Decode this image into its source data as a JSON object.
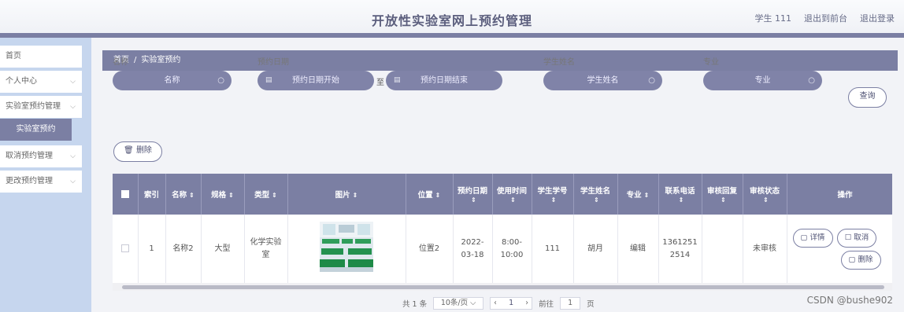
{
  "header": {
    "title": "开放性实验室网上预约管理",
    "user_label": "学生 111",
    "to_front_label": "退出到前台",
    "logout_label": "退出登录"
  },
  "sidebar": {
    "items": [
      {
        "label": "首页",
        "chevron": false
      },
      {
        "label": "个人中心",
        "chevron": true
      },
      {
        "label": "实验室预约管理",
        "chevron": true
      },
      {
        "label": "取消预约管理",
        "chevron": true
      },
      {
        "label": "更改预约管理",
        "chevron": true
      }
    ],
    "active_sub": "实验室预约"
  },
  "breadcrumb": {
    "home": "首页",
    "separator": "/",
    "current": "实验室预约"
  },
  "filters": {
    "name_label": "名称",
    "name_placeholder": "名称",
    "date_label": "预约日期",
    "date_start_placeholder": "预约日期开始",
    "date_to": "至",
    "date_end_placeholder": "预约日期结束",
    "student_label": "学生姓名",
    "student_placeholder": "学生姓名",
    "major_label": "专业",
    "major_placeholder": "专业",
    "query_button": "查询",
    "delete_button": "删除",
    "delete_icon": "trash-icon"
  },
  "table": {
    "headers": [
      "",
      "索引",
      "名称",
      "规格",
      "类型",
      "图片",
      "位置",
      "预约日期",
      "使用时间",
      "学生学号",
      "学生姓名",
      "专业",
      "联系电话",
      "审核回复",
      "审核状态",
      "操作"
    ],
    "rows": [
      {
        "index": "1",
        "name": "名称2",
        "spec": "大型",
        "type": "化学实验室",
        "image": "classroom-photo",
        "location": "位置2",
        "date": "2022-03-18",
        "time": "8:00-10:00",
        "student_id": "111",
        "student_name": "胡月",
        "major": "编辑",
        "phone": "13612512514",
        "reply": "",
        "status": "未审核",
        "actions": {
          "detail": "详情",
          "cancel": "取消",
          "delete": "删除"
        }
      }
    ]
  },
  "pagination": {
    "total": "共 1 条",
    "page_size": "10条/页",
    "current_page": "1",
    "goto_label": "前往",
    "goto_value": "1",
    "page_unit": "页"
  },
  "watermark": "CSDN @bushe902",
  "colors": {
    "accent": "#7b7fa3",
    "sidebar": "#c6d6ee"
  }
}
